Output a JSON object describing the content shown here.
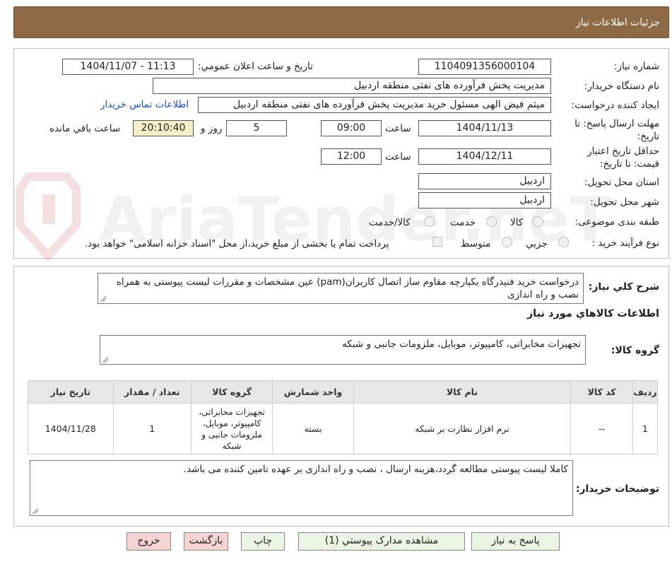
{
  "header": {
    "title": "جزئیات اطلاعات نیاز"
  },
  "need": {
    "number_label": "شماره نیاز:",
    "number_value": "1104091356000104",
    "announce_label": "تاریخ و ساعت اعلان عمومي:",
    "announce_value": "1404/11/07 - 11:13",
    "buyer_label": "نام دستگاه خريدار:",
    "buyer_value": "مديريت پخش فرآورده هاى نفتى منطقه اردبيل",
    "creator_label": "ايجاد کننده درخواست:",
    "creator_value": "میثم فیض الهی مسئول خرید مديريت پخش فرآورده هاى نفتى منطقه اردبيل",
    "contact_link": "اطلاعات تماس خريدار",
    "deadline_label": "مهلت ارسال پاسخ: تا تاريخ:",
    "deadline_date": "1404/11/13",
    "time_label": "ساعت",
    "deadline_time": "09:00",
    "days_value": "5",
    "days_label": "روز و",
    "remaining_time": "20:10:40",
    "remaining_label": "ساعت باقي مانده",
    "validity_label": "حداقل تاريخ اعتبار قيمت: تا تاريخ:",
    "validity_date": "1404/12/11",
    "validity_time_label": "ساعت",
    "validity_time": "12:00",
    "province_label": "استان محل تحويل:",
    "province_value": "اردبيل",
    "city_label": "شهر محل تحويل:",
    "city_value": "اردبيل",
    "category_label": "طبقه بندی موضوعی:",
    "category_options": [
      "کالا",
      "خدمت",
      "کالا/خدمت"
    ],
    "process_label": "نوع فرآيند خريد :",
    "process_options": [
      "جزيي",
      "متوسط"
    ],
    "payment_note": "پرداخت تمام يا بخشی از مبلغ خريد،از محل \"اسناد خزانه اسلامی\" خواهد بود."
  },
  "description": {
    "label": "شرح کلي نياز:",
    "value": "درخواست خرید فنیدرگاه یکپارچه مقاوم ساز اتصال کاربران(pam) عین مشخصات و مقررات لیست پیوستی به همراه نصب و راه اندازی"
  },
  "goods": {
    "section_title": "اطلاعات کالاهاي مورد نياز",
    "group_label": "گروه کالا:",
    "group_value": "تجهیزات مخابراتی، کامپیوتر، موبایل، ملزومات جانبی و شبکه",
    "columns": [
      "رديف",
      "کد کالا",
      "نام کالا",
      "واحد شمارش",
      "گروه کالا",
      "تعداد / مقدار",
      "تاريخ نياز"
    ],
    "rows": [
      {
        "index": "1",
        "code": "--",
        "name": "نرم افزار نظارت بر شبکه",
        "unit": "بسته",
        "group": "تجهیزات مخابراتی، کامپیوتر، موبایل، ملزومات جانبی و شبکه",
        "qty": "1",
        "date": "1404/11/28"
      }
    ]
  },
  "buyer_notes": {
    "label": "توضيحات خريدار:",
    "value": "کاملا لیست پیوستی مطالعه گردد،هزینه ارسال ، نصب و راه اندازی بر عهده تامین کننده می باشد."
  },
  "buttons": {
    "reply": "پاسخ به نياز",
    "attachments": "مشاهده مدارک پيوستي (1)",
    "print": "چاپ",
    "back": "بازگشت",
    "exit": "خروج"
  },
  "watermark": {
    "text": "AriaTender.neT"
  },
  "colors": {
    "header": "#8e6a47",
    "button": "#eaf6e3",
    "button_red": "#f7d4d4",
    "highlight": "#f5f0c8",
    "link": "#1a4fc9"
  }
}
